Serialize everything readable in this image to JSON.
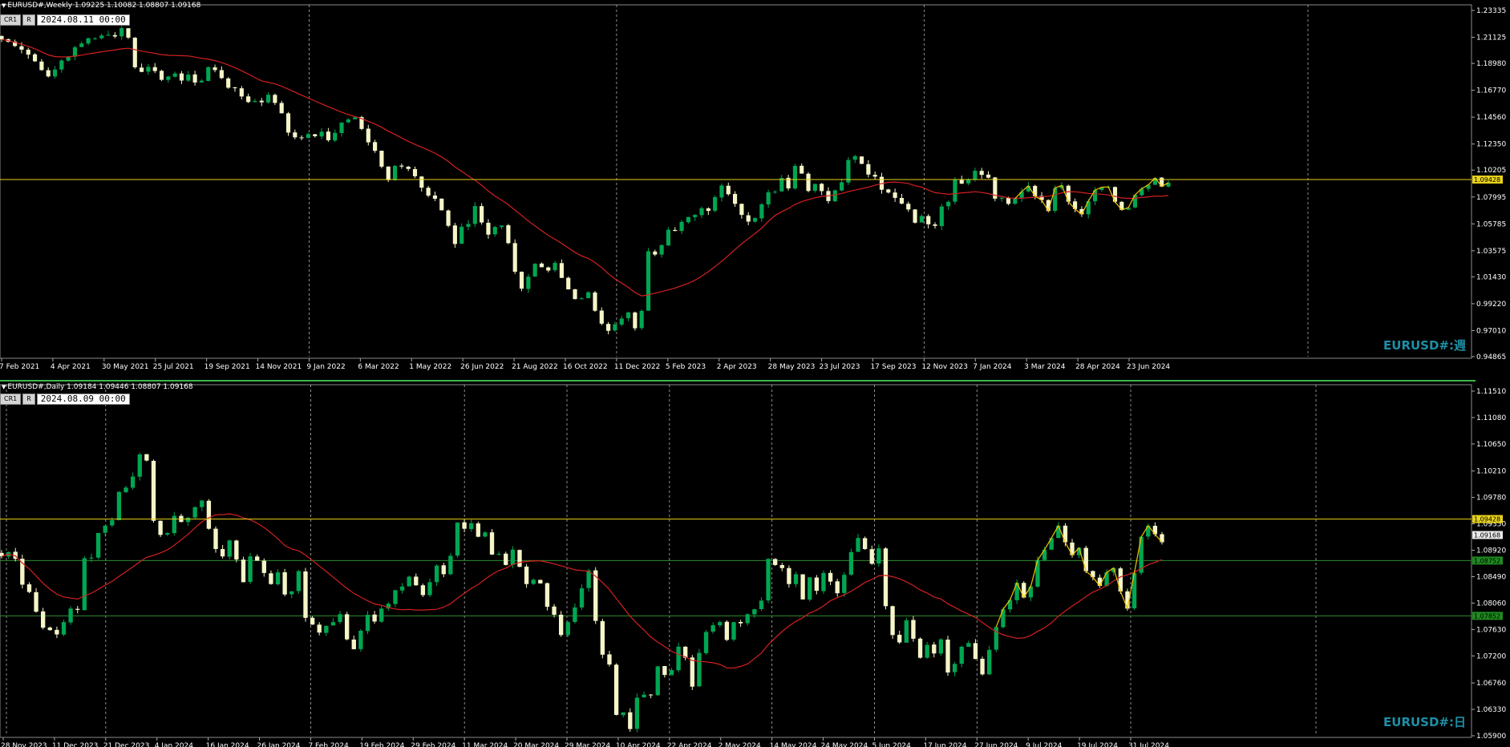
{
  "colors": {
    "bg": "#000000",
    "bull": "#00a651",
    "bear": "#f5f5c8",
    "ma": "#d42020",
    "zigzag": "#f2c200",
    "hline": "#e8d21a",
    "support": "#2e8b2e",
    "grid": "#b0b0b0",
    "watermark": "#1e8fa6"
  },
  "weekly": {
    "header": "EURUSD#,Weekly  1.09225 1.10082 1.08807 1.09168",
    "ctrl_a": "CR1",
    "ctrl_b": "R",
    "date": "2024.08.11  00:00",
    "watermark": "EURUSD#:週",
    "price_labels": [
      "1.23335",
      "1.21125",
      "1.18980",
      "1.16770",
      "1.14560",
      "1.12350",
      "1.10205",
      "1.07995",
      "1.05785",
      "1.03575",
      "1.01430",
      "0.99220",
      "0.97010",
      "0.94865"
    ],
    "price_min": 0.94865,
    "price_max": 1.23335,
    "hline_price": 1.09428,
    "hline_tag": "1.09428",
    "x_labels": [
      "7 Feb 2021",
      "4 Apr 2021",
      "30 May 2021",
      "25 Jul 2021",
      "19 Sep 2021",
      "14 Nov 2021",
      "9 Jan 2022",
      "6 Mar 2022",
      "1 May 2022",
      "26 Jun 2022",
      "21 Aug 2022",
      "16 Oct 2022",
      "11 Dec 2022",
      "5 Feb 2023",
      "2 Apr 2023",
      "28 May 2023",
      "23 Jul 2023",
      "17 Sep 2023",
      "12 Nov 2023",
      "7 Jan 2024",
      "3 Mar 2024",
      "28 Apr 2024",
      "23 Jun 2024"
    ],
    "vgrid_label_idx": [
      6,
      12,
      18
    ],
    "closes": [
      1.2095,
      1.2075,
      1.2041,
      1.2011,
      1.197,
      1.1915,
      1.1843,
      1.1791,
      1.1847,
      1.1922,
      1.1955,
      1.203,
      1.2062,
      1.2105,
      1.2105,
      1.2127,
      1.2133,
      1.2119,
      1.2188,
      1.211,
      1.1866,
      1.1828,
      1.1869,
      1.1835,
      1.1763,
      1.179,
      1.1815,
      1.1757,
      1.1806,
      1.1741,
      1.1756,
      1.1867,
      1.1843,
      1.1777,
      1.1698,
      1.1694,
      1.1626,
      1.158,
      1.1589,
      1.1578,
      1.164,
      1.1573,
      1.1488,
      1.1329,
      1.129,
      1.1285,
      1.1317,
      1.1299,
      1.1336,
      1.1266,
      1.1327,
      1.1412,
      1.1437,
      1.1454,
      1.1359,
      1.1249,
      1.1179,
      1.1049,
      1.0938,
      1.1055,
      1.105,
      1.103,
      1.097,
      1.0876,
      1.0811,
      1.0785,
      1.069,
      1.0563,
      1.0413,
      1.0555,
      1.0578,
      1.0725,
      1.059,
      1.049,
      1.0553,
      1.0565,
      1.042,
      1.0185,
      1.0046,
      1.0144,
      1.025,
      1.0222,
      1.0195,
      1.0258,
      1.0134,
      1.004,
      0.996,
      0.9966,
      1.0016,
      0.9864,
      0.9758,
      0.9699,
      0.9753,
      0.98,
      0.985,
      0.972,
      0.9863,
      1.0353,
      1.0326,
      1.0404,
      1.053,
      1.052,
      1.0595,
      1.0635,
      1.0652,
      1.0707,
      1.0685,
      1.0798,
      1.0894,
      1.0822,
      1.0743,
      1.0652,
      1.0597,
      1.0626,
      1.0739,
      1.0838,
      1.0843,
      1.0956,
      1.087,
      1.1055,
      1.0992,
      1.0849,
      1.0907,
      1.0848,
      1.0766,
      1.0854,
      1.0921,
      1.1104,
      1.1135,
      1.1072,
      1.0984,
      1.0967,
      1.0859,
      1.0836,
      1.0792,
      1.0745,
      1.0697,
      1.0588,
      1.0643,
      1.0575,
      1.0562,
      1.0721,
      1.076,
      1.0942,
      1.0909,
      1.0944,
      1.1015,
      1.0981,
      1.0958,
      1.0786,
      1.0793,
      1.0743,
      1.0787,
      1.0843,
      1.0891,
      1.0806,
      1.0774,
      1.0684,
      1.0873,
      1.0895,
      1.0761,
      1.07,
      1.0657,
      1.0765,
      1.0856,
      1.088,
      1.0882,
      1.076,
      1.0693,
      1.0713,
      1.0817,
      1.0867,
      1.09,
      1.0956,
      1.0885,
      1.0917
    ]
  },
  "daily": {
    "header": "EURUSD#,Daily  1.09184 1.09446 1.08807 1.09168",
    "ctrl_a": "CR1",
    "ctrl_b": "R",
    "date": "2024.08.09  00:00",
    "watermark": "EURUSD#:日",
    "price_labels": [
      "1.11510",
      "1.11080",
      "1.10650",
      "1.10210",
      "1.09780",
      "1.09350",
      "1.08920",
      "1.08490",
      "1.08060",
      "1.07630",
      "1.07200",
      "1.06760",
      "1.06330",
      "1.05900"
    ],
    "price_min": 1.059,
    "price_max": 1.1151,
    "hline_price": 1.09428,
    "hline_tag": "1.09428",
    "close_tag": "1.09168",
    "support_upper": 1.08752,
    "support_upper_tag": "1.08752",
    "support_lower": 1.07852,
    "support_lower_tag": "1.07852",
    "x_labels": [
      "28 Nov 2023",
      "11 Dec 2023",
      "21 Dec 2023",
      "4 Jan 2024",
      "16 Jan 2024",
      "26 Jan 2024",
      "7 Feb 2024",
      "19 Feb 2024",
      "29 Feb 2024",
      "11 Mar 2024",
      "20 Mar 2024",
      "29 Mar 2024",
      "10 Apr 2024",
      "22 Apr 2024",
      "2 May 2024",
      "14 May 2024",
      "24 May 2024",
      "5 Jun 2024",
      "17 Jun 2024",
      "27 Jun 2024",
      "9 Jul 2024",
      "19 Jul 2024",
      "31 Jul 2024"
    ],
    "vgrid_label_idx": [
      2,
      6,
      9,
      11,
      13,
      15,
      17,
      19,
      22
    ],
    "closes": [
      1.0882,
      1.0889,
      1.0878,
      1.0836,
      1.0824,
      1.0792,
      1.0766,
      1.0762,
      1.0755,
      1.0775,
      1.0797,
      1.0795,
      1.0879,
      1.088,
      1.092,
      1.0932,
      1.0941,
      1.0987,
      1.0994,
      1.1012,
      1.1048,
      1.1038,
      1.094,
      1.0917,
      1.092,
      1.0948,
      1.0938,
      1.0945,
      1.0962,
      1.0973,
      1.0927,
      1.0894,
      1.0882,
      1.0908,
      1.0877,
      1.084,
      1.0882,
      1.0875,
      1.0855,
      1.0837,
      1.0856,
      1.082,
      1.0825,
      1.0858,
      1.0782,
      1.0771,
      1.0758,
      1.0769,
      1.0775,
      1.0788,
      1.0747,
      1.0731,
      1.0761,
      1.0787,
      1.0776,
      1.0797,
      1.0805,
      1.0827,
      1.0833,
      1.0849,
      1.0835,
      1.0819,
      1.084,
      1.0867,
      1.0853,
      1.0883,
      1.0937,
      1.0927,
      1.0936,
      1.0914,
      1.0921,
      1.0885,
      1.0886,
      1.0868,
      1.0893,
      1.0865,
      1.0837,
      1.0844,
      1.0838,
      1.08,
      1.0787,
      1.0754,
      1.0775,
      1.0799,
      1.083,
      1.0859,
      1.0777,
      1.0722,
      1.0706,
      1.0624,
      1.0628,
      1.0601,
      1.0652,
      1.0657,
      1.0656,
      1.0703,
      1.0689,
      1.0697,
      1.0735,
      1.0717,
      1.067,
      1.0725,
      1.0759,
      1.077,
      1.0775,
      1.0746,
      1.0775,
      1.0773,
      1.0788,
      1.0796,
      1.081,
      1.0878,
      1.0868,
      1.0863,
      1.0837,
      1.0853,
      1.0812,
      1.0848,
      1.0826,
      1.0855,
      1.0841,
      1.0822,
      1.0852,
      1.0889,
      1.0912,
      1.0894,
      1.087,
      1.0895,
      1.0801,
      1.0754,
      1.0742,
      1.0778,
      1.0748,
      1.0717,
      1.0738,
      1.0724,
      1.0747,
      1.0693,
      1.0707,
      1.0735,
      1.0741,
      1.0715,
      1.069,
      1.073,
      1.0767,
      1.0796,
      1.0811,
      1.0839,
      1.0815,
      1.0833,
      1.0876,
      1.0893,
      1.0912,
      1.0932,
      1.0905,
      1.0884,
      1.0896,
      1.0858,
      1.0848,
      1.0834,
      1.0856,
      1.0863,
      1.0825,
      1.0797,
      1.0855,
      1.0914,
      1.0932,
      1.0918,
      1.0905
    ]
  }
}
